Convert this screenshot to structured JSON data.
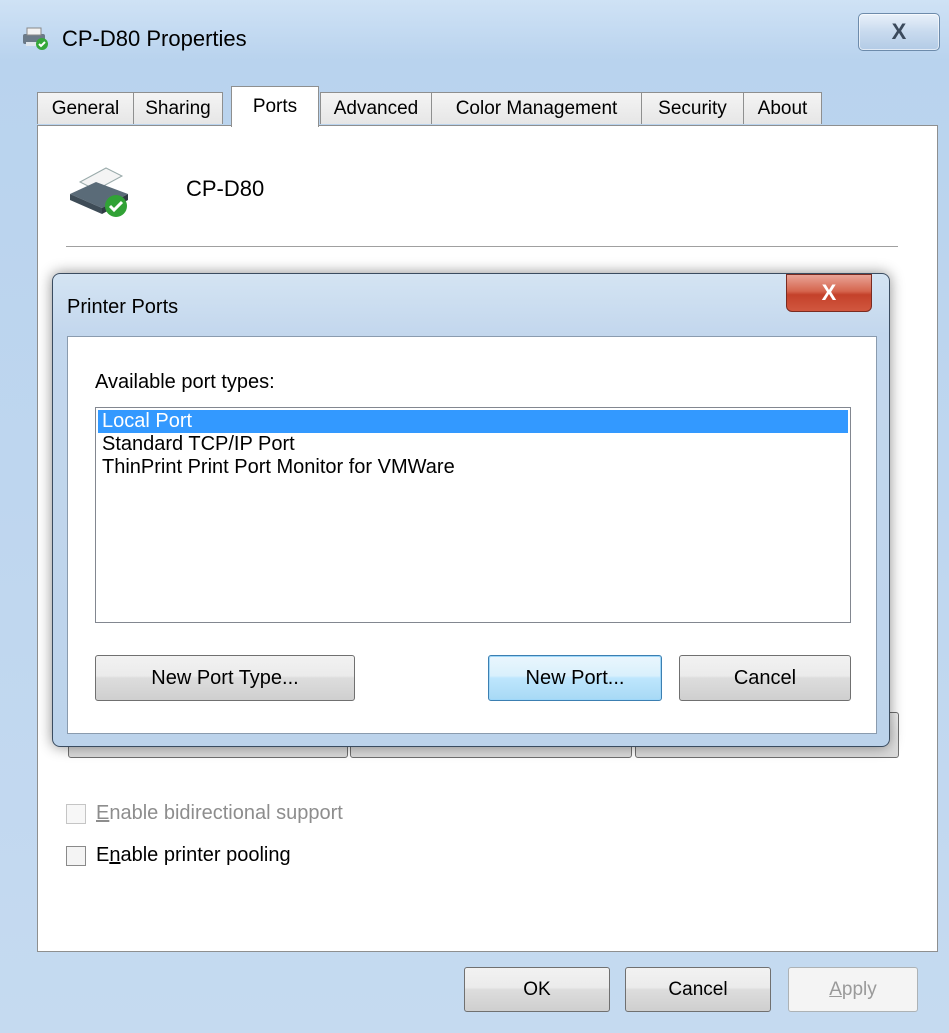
{
  "window": {
    "title": "CP-D80 Properties",
    "close_glyph": "X"
  },
  "tabs": [
    {
      "label": "General",
      "active": false
    },
    {
      "label": "Sharing",
      "active": false
    },
    {
      "label": "Ports",
      "active": true
    },
    {
      "label": "Advanced",
      "active": false
    },
    {
      "label": "Color Management",
      "active": false
    },
    {
      "label": "Security",
      "active": false
    },
    {
      "label": "About",
      "active": false
    }
  ],
  "ports_tab": {
    "printer_name": "CP-D80",
    "bidirectional": {
      "label_first": "E",
      "label_rest": "nable bidirectional support",
      "checked": false,
      "enabled": false
    },
    "pooling": {
      "label_first": "E",
      "label_mid": "n",
      "label_rest": "able printer pooling",
      "checked": false,
      "enabled": true
    }
  },
  "dialog": {
    "title": "Printer Ports",
    "close_glyph": "X",
    "available_label": "Available port types:",
    "port_types": [
      {
        "label": "Local Port",
        "selected": true
      },
      {
        "label": "Standard TCP/IP Port",
        "selected": false
      },
      {
        "label": "ThinPrint Print Port Monitor for VMWare",
        "selected": false
      }
    ],
    "new_port_type_label": "New Port Type...",
    "new_port_label": "New Port...",
    "cancel_label": "Cancel"
  },
  "footer": {
    "ok_label": "OK",
    "cancel_label": "Cancel",
    "apply_first": "A",
    "apply_rest": "pply"
  },
  "colors": {
    "selection": "#3399ff",
    "close_red": "#c4412a"
  }
}
